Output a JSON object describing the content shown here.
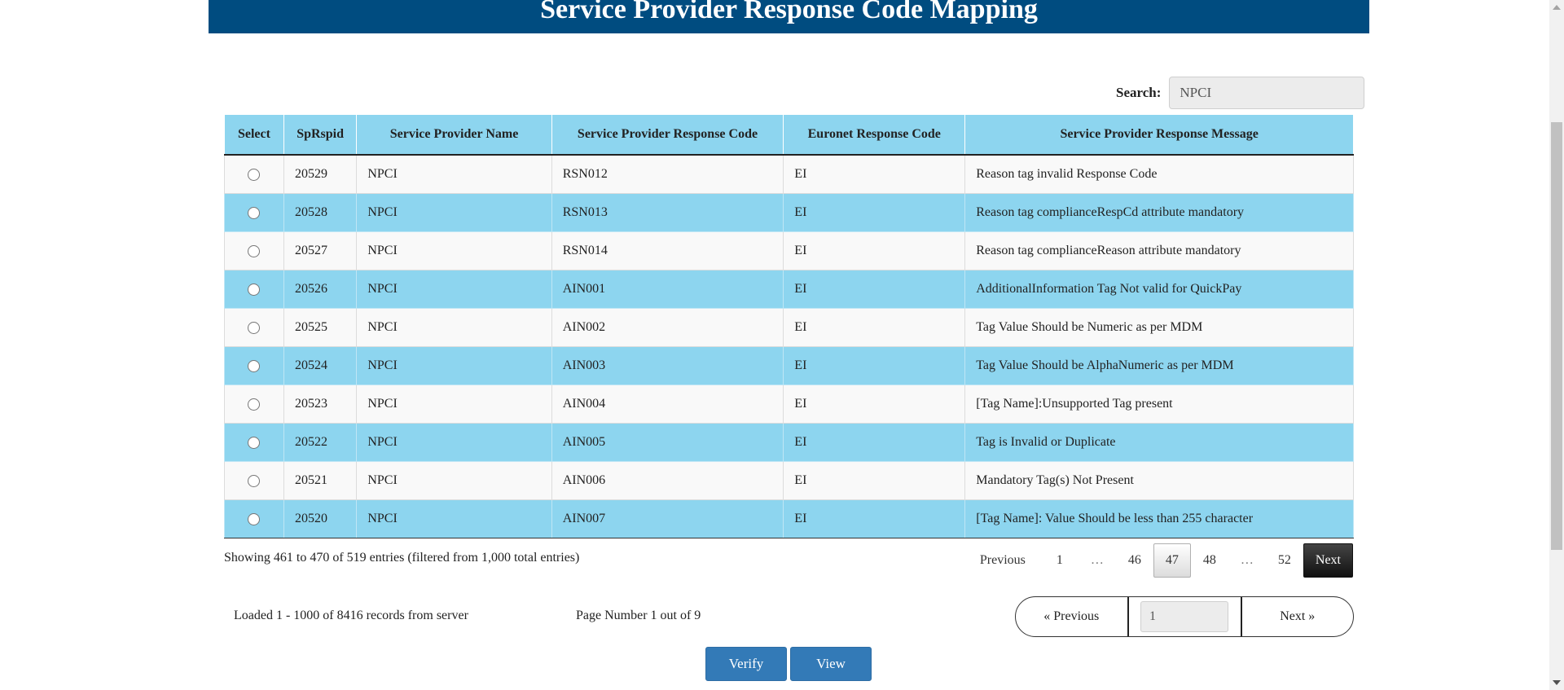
{
  "header": {
    "title": "Service Provider Response Code Mapping"
  },
  "search": {
    "label": "Search:",
    "value": "NPCI"
  },
  "table": {
    "columns": [
      "Select",
      "SpRspid",
      "Service Provider Name",
      "Service Provider Response Code",
      "Euronet Response Code",
      "Service Provider Response Message"
    ],
    "rows": [
      {
        "id": "20529",
        "name": "NPCI",
        "sp_code": "RSN012",
        "euronet_code": "EI",
        "message": "Reason tag invalid Response Code"
      },
      {
        "id": "20528",
        "name": "NPCI",
        "sp_code": "RSN013",
        "euronet_code": "EI",
        "message": "Reason tag complianceRespCd attribute mandatory"
      },
      {
        "id": "20527",
        "name": "NPCI",
        "sp_code": "RSN014",
        "euronet_code": "EI",
        "message": "Reason tag complianceReason attribute mandatory"
      },
      {
        "id": "20526",
        "name": "NPCI",
        "sp_code": "AIN001",
        "euronet_code": "EI",
        "message": "AdditionalInformation Tag Not valid for QuickPay"
      },
      {
        "id": "20525",
        "name": "NPCI",
        "sp_code": "AIN002",
        "euronet_code": "EI",
        "message": "Tag Value Should be Numeric as per MDM"
      },
      {
        "id": "20524",
        "name": "NPCI",
        "sp_code": "AIN003",
        "euronet_code": "EI",
        "message": "Tag Value Should be AlphaNumeric as per MDM"
      },
      {
        "id": "20523",
        "name": "NPCI",
        "sp_code": "AIN004",
        "euronet_code": "EI",
        "message": "[Tag Name]:Unsupported Tag present"
      },
      {
        "id": "20522",
        "name": "NPCI",
        "sp_code": "AIN005",
        "euronet_code": "EI",
        "message": "Tag is Invalid or Duplicate"
      },
      {
        "id": "20521",
        "name": "NPCI",
        "sp_code": "AIN006",
        "euronet_code": "EI",
        "message": "Mandatory Tag(s) Not Present"
      },
      {
        "id": "20520",
        "name": "NPCI",
        "sp_code": "AIN007",
        "euronet_code": "EI",
        "message": "[Tag Name]: Value Should be less than 255 character"
      }
    ]
  },
  "table_info": "Showing 461 to 470 of 519 entries (filtered from 1,000 total entries)",
  "pagination": {
    "previous": "Previous",
    "pages": [
      "1",
      "…",
      "46",
      "47",
      "48",
      "…",
      "52"
    ],
    "current": "47",
    "next": "Next"
  },
  "server": {
    "loaded_text": "Loaded 1 - 1000 of 8416 records from server",
    "page_number_text": "Page Number 1 out of 9",
    "previous_label": "«  Previous",
    "page_input_value": "1",
    "next_label": "Next  »"
  },
  "actions": {
    "verify": "Verify",
    "view": "View"
  },
  "colors": {
    "header_bg": "#004c80",
    "row_highlight": "#8dd5ef",
    "button": "#337ab7"
  }
}
